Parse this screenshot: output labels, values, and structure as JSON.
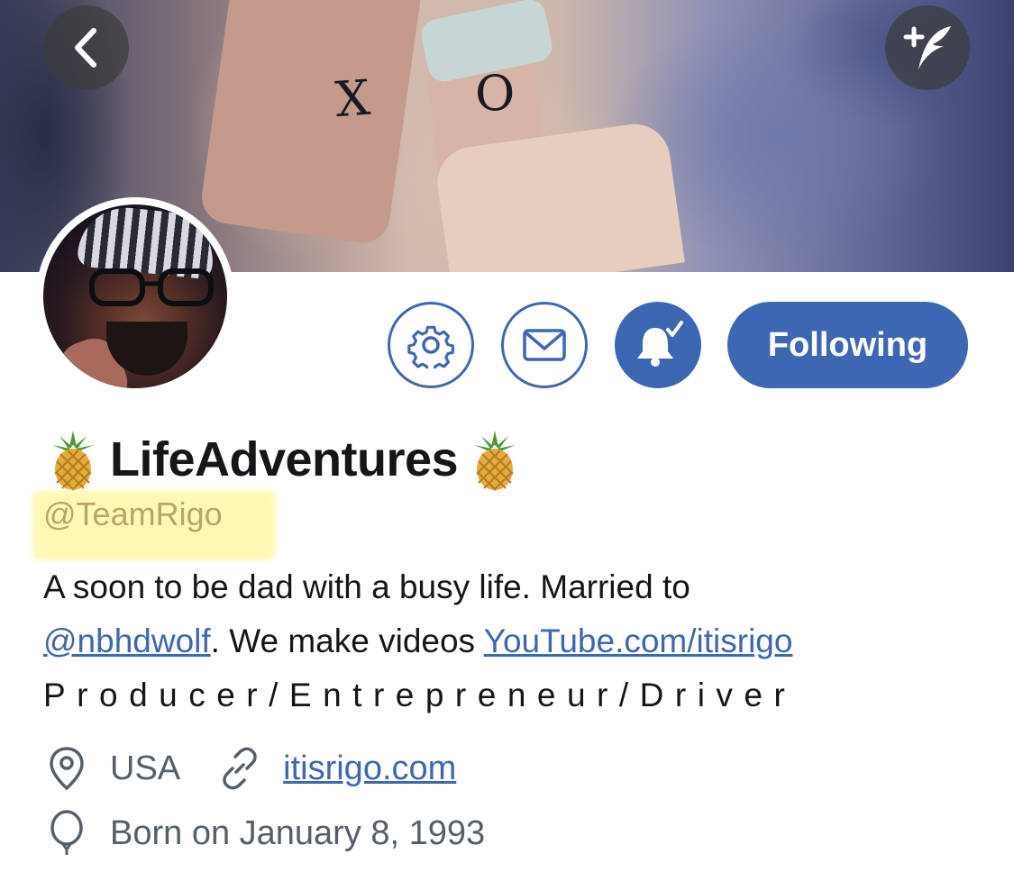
{
  "header": {
    "back_icon": "chevron-left-icon",
    "compose_icon": "compose-tweet-icon"
  },
  "profile": {
    "display_name": "LifeAdventures",
    "name_emoji": "pineapple",
    "handle": "@TeamRigo",
    "bio_line1": "A soon to be dad with a busy life. Married to",
    "bio_mention": "@nbhdwolf",
    "bio_mid": ". We make videos ",
    "bio_link": "YouTube.com/itisrigo",
    "bio_line3": "Producer/Entrepreneur/Driver",
    "location": "USA",
    "website": "itisrigo.com",
    "birthday": "Born on January 8, 1993"
  },
  "actions": {
    "settings_icon": "gear-icon",
    "message_icon": "envelope-icon",
    "notify_icon": "bell-check-icon",
    "following_label": "Following"
  },
  "colors": {
    "accent": "#3d67b3",
    "handle_highlight": "#fff378",
    "meta_text": "#555f6a"
  }
}
